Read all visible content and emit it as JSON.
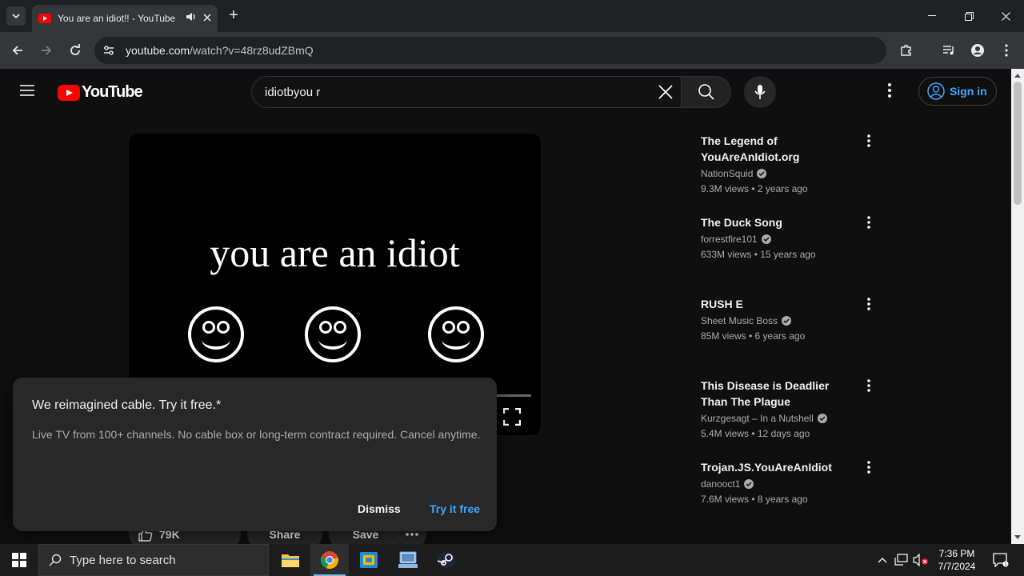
{
  "browser": {
    "tab_title": "You are an idiot!! - YouTube",
    "url_host": "youtube.com",
    "url_path": "/watch?v=48rz8udZBmQ"
  },
  "youtube": {
    "logo_text": "YouTube",
    "search_query": "idiotbyou r",
    "signin_label": "Sign in"
  },
  "video": {
    "overlay_text": "you are an idiot"
  },
  "actions": {
    "likes": "79K",
    "share": "Share",
    "save": "Save"
  },
  "popup": {
    "title": "We reimagined cable. Try it free.*",
    "body": "Live TV from 100+ channels. No cable box or long-term contract required. Cancel anytime.",
    "dismiss": "Dismiss",
    "try": "Try it free"
  },
  "recommendations": [
    {
      "title": "The Legend of YouAreAnIdiot.org",
      "channel": "NationSquid",
      "meta": "9.3M views  • 2 years ago"
    },
    {
      "title": "The Duck Song",
      "channel": "forrestfire101",
      "meta": "633M views  • 15 years ago"
    },
    {
      "title": "RUSH E",
      "channel": "Sheet Music Boss",
      "meta": "85M views  • 6 years ago"
    },
    {
      "title": "This Disease is Deadlier Than The Plague",
      "channel": "Kurzgesagt – In a Nutshell",
      "meta": "5.4M views  • 12 days ago"
    },
    {
      "title": "Trojan.JS.YouAreAnIdiot",
      "channel": "danooct1",
      "meta": "7.6M views  • 8 years ago"
    }
  ],
  "taskbar": {
    "search_placeholder": "Type here to search",
    "time": "7:36 PM",
    "date": "7/7/2024"
  }
}
